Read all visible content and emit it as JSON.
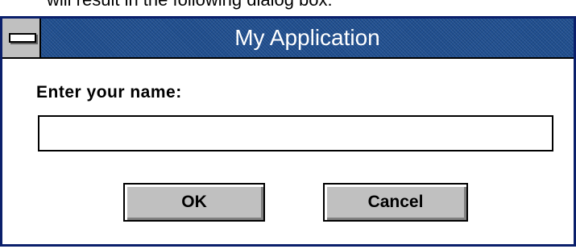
{
  "caption": {
    "text": "will result in the following dialog box:"
  },
  "dialog": {
    "title": "My Application",
    "prompt_label": "Enter your name:",
    "name_input": {
      "value": "",
      "placeholder": ""
    },
    "buttons": {
      "ok_label": "OK",
      "cancel_label": "Cancel"
    }
  },
  "icons": {
    "system_menu": "system-menu-icon"
  },
  "colors": {
    "title_bar": "#1f4e8f",
    "frame": "#0a1f6b",
    "button_face": "#c0c0c0",
    "title_text": "#ffffff"
  }
}
